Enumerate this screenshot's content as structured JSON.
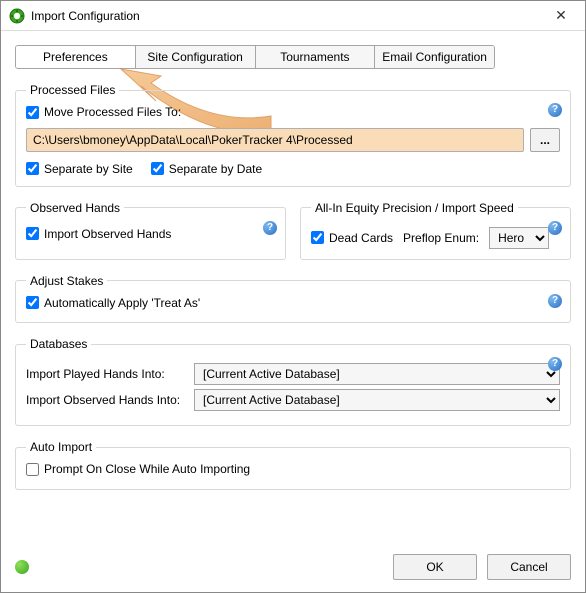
{
  "window": {
    "title": "Import Configuration",
    "close_glyph": "✕"
  },
  "tabs": {
    "preferences": "Preferences",
    "site_config": "Site Configuration",
    "tournaments": "Tournaments",
    "email_config": "Email Configuration",
    "active": "preferences"
  },
  "processed_files": {
    "legend": "Processed Files",
    "move_label": "Move Processed Files To:",
    "move_checked": true,
    "path": "C:\\Users\\bmoney\\AppData\\Local\\PokerTracker 4\\Processed",
    "browse_label": "...",
    "sep_site_label": "Separate by Site",
    "sep_site_checked": true,
    "sep_date_label": "Separate by Date",
    "sep_date_checked": true
  },
  "observed_hands": {
    "legend": "Observed Hands",
    "import_label": "Import Observed Hands",
    "import_checked": true
  },
  "allin_equity": {
    "legend": "All-In Equity Precision / Import Speed",
    "dead_cards_label": "Dead Cards",
    "dead_cards_checked": true,
    "preflop_enum_label": "Preflop Enum:",
    "preflop_enum_value": "Hero"
  },
  "adjust_stakes": {
    "legend": "Adjust Stakes",
    "treat_as_label": "Automatically Apply 'Treat As'",
    "treat_as_checked": true
  },
  "databases": {
    "legend": "Databases",
    "played_label": "Import Played Hands Into:",
    "played_value": "[Current Active Database]",
    "observed_label": "Import Observed Hands Into:",
    "observed_value": "[Current Active Database]"
  },
  "auto_import": {
    "legend": "Auto Import",
    "prompt_label": "Prompt On Close While Auto Importing",
    "prompt_checked": false
  },
  "footer": {
    "ok_label": "OK",
    "cancel_label": "Cancel"
  },
  "help_glyph": "?"
}
